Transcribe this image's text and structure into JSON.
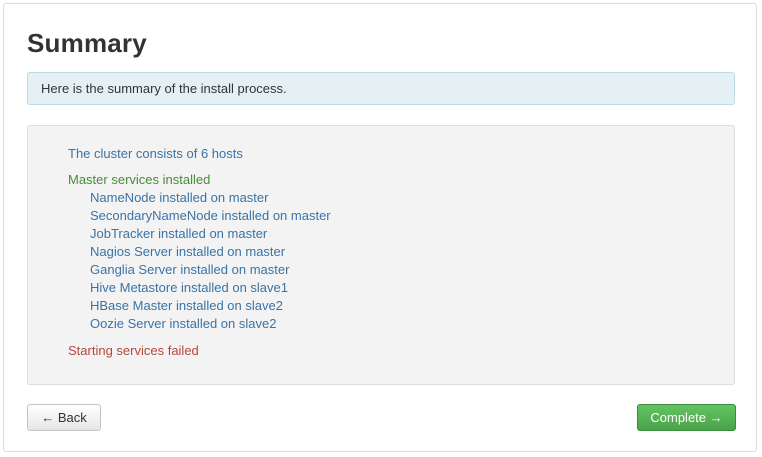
{
  "page": {
    "title": "Summary",
    "info_message": "Here is the summary of the install process."
  },
  "summary": {
    "cluster_text": "The cluster consists of 6 hosts",
    "master_heading": "Master services installed",
    "services": [
      "NameNode installed on master",
      "SecondaryNameNode installed on master",
      "JobTracker installed on master",
      "Nagios Server installed on master",
      "Ganglia Server installed on master",
      "Hive Metastore installed on slave1",
      "HBase Master installed on slave2",
      "Oozie Server installed on slave2"
    ],
    "status_text": "Starting services failed"
  },
  "buttons": {
    "back_label": "← Back",
    "complete_label": "Complete →"
  },
  "colors": {
    "info_text": "#3b73a6",
    "success": "#4a8a3d",
    "error": "#b8463d",
    "complete_button": "#5bb75b"
  }
}
